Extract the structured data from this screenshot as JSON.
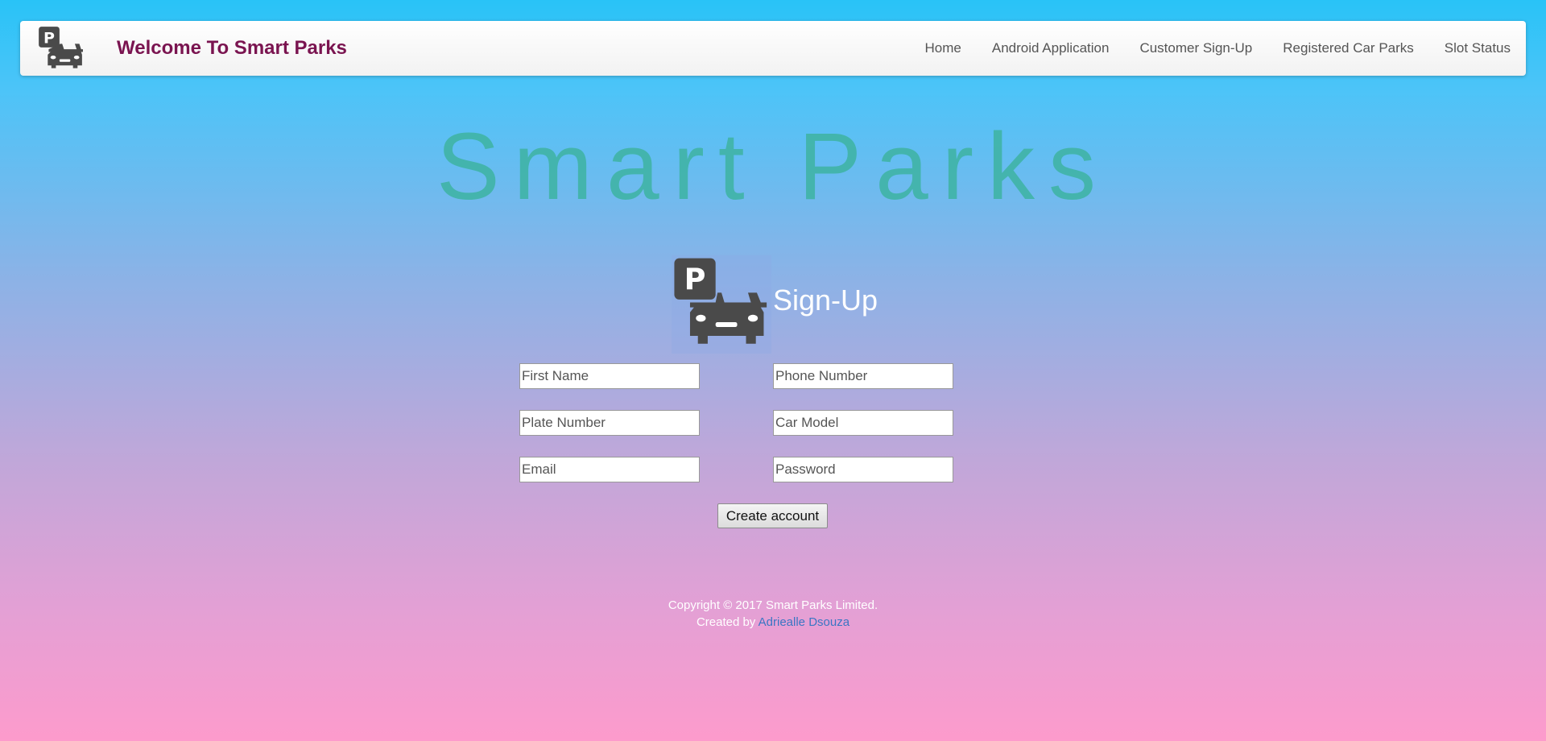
{
  "header": {
    "logo_icon": "parking-car-icon",
    "brand": "Welcome To Smart Parks",
    "brand_color": "#7a1450",
    "nav": [
      {
        "label": "Home"
      },
      {
        "label": "Android Application"
      },
      {
        "label": "Customer Sign-Up"
      },
      {
        "label": "Registered Car Parks"
      },
      {
        "label": "Slot Status"
      }
    ]
  },
  "hero": {
    "title": "Smart Parks",
    "color": "#40b4a6"
  },
  "signup": {
    "icon": "parking-car-icon",
    "title": "Sign-Up",
    "fields": {
      "first_name": {
        "placeholder": "First Name",
        "value": ""
      },
      "phone_number": {
        "placeholder": "Phone Number",
        "value": ""
      },
      "plate_number": {
        "placeholder": "Plate Number",
        "value": ""
      },
      "car_model": {
        "placeholder": "Car Model",
        "value": ""
      },
      "email": {
        "placeholder": "Email",
        "value": ""
      },
      "password": {
        "placeholder": "Password",
        "value": ""
      }
    },
    "submit_label": "Create account"
  },
  "footer": {
    "copyright": "Copyright © 2017 Smart Parks Limited.",
    "created_by": "Created by ",
    "author_link": "Adriealle Dsouza",
    "link_color": "#3a76c4"
  }
}
